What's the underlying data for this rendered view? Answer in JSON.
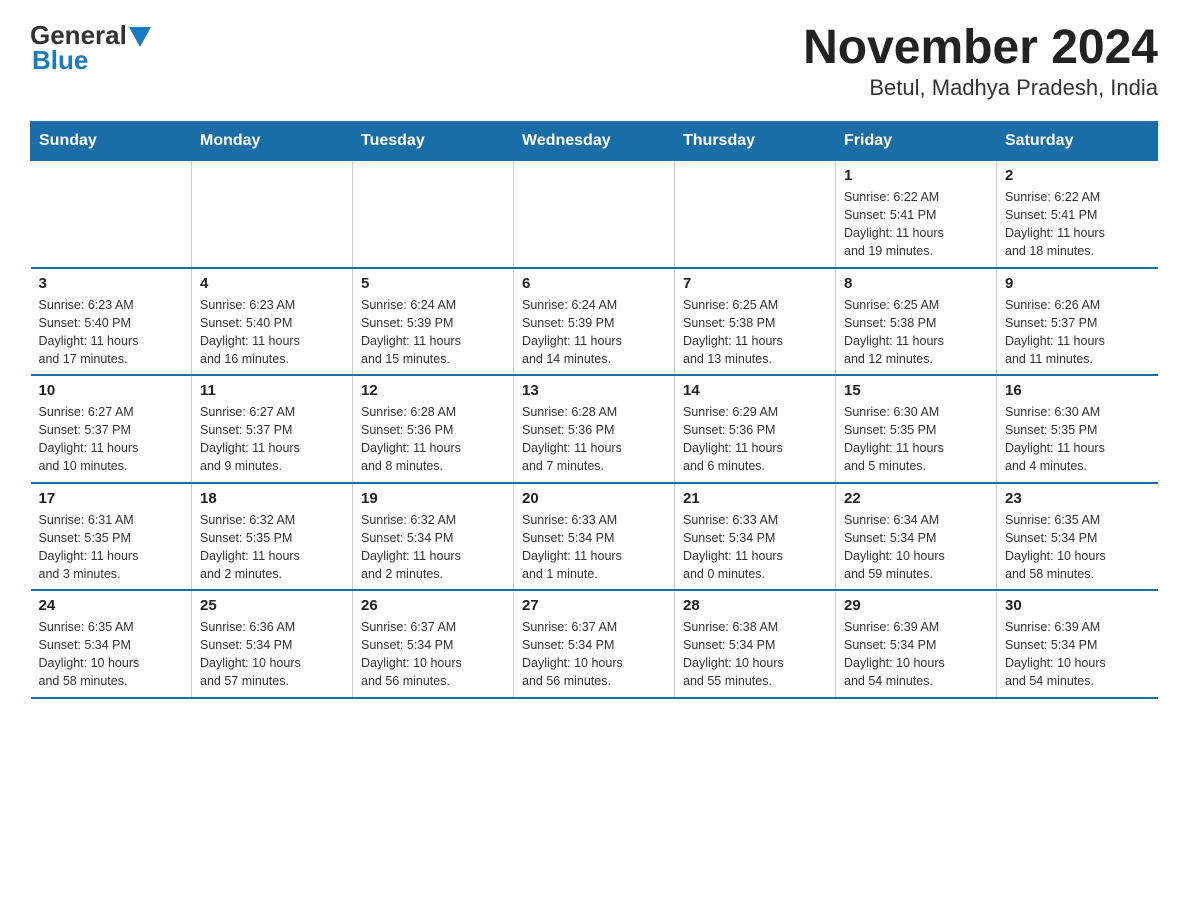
{
  "logo": {
    "general": "General",
    "blue": "Blue"
  },
  "title": "November 2024",
  "subtitle": "Betul, Madhya Pradesh, India",
  "days_header": [
    "Sunday",
    "Monday",
    "Tuesday",
    "Wednesday",
    "Thursday",
    "Friday",
    "Saturday"
  ],
  "weeks": [
    [
      {
        "day": "",
        "info": ""
      },
      {
        "day": "",
        "info": ""
      },
      {
        "day": "",
        "info": ""
      },
      {
        "day": "",
        "info": ""
      },
      {
        "day": "",
        "info": ""
      },
      {
        "day": "1",
        "info": "Sunrise: 6:22 AM\nSunset: 5:41 PM\nDaylight: 11 hours\nand 19 minutes."
      },
      {
        "day": "2",
        "info": "Sunrise: 6:22 AM\nSunset: 5:41 PM\nDaylight: 11 hours\nand 18 minutes."
      }
    ],
    [
      {
        "day": "3",
        "info": "Sunrise: 6:23 AM\nSunset: 5:40 PM\nDaylight: 11 hours\nand 17 minutes."
      },
      {
        "day": "4",
        "info": "Sunrise: 6:23 AM\nSunset: 5:40 PM\nDaylight: 11 hours\nand 16 minutes."
      },
      {
        "day": "5",
        "info": "Sunrise: 6:24 AM\nSunset: 5:39 PM\nDaylight: 11 hours\nand 15 minutes."
      },
      {
        "day": "6",
        "info": "Sunrise: 6:24 AM\nSunset: 5:39 PM\nDaylight: 11 hours\nand 14 minutes."
      },
      {
        "day": "7",
        "info": "Sunrise: 6:25 AM\nSunset: 5:38 PM\nDaylight: 11 hours\nand 13 minutes."
      },
      {
        "day": "8",
        "info": "Sunrise: 6:25 AM\nSunset: 5:38 PM\nDaylight: 11 hours\nand 12 minutes."
      },
      {
        "day": "9",
        "info": "Sunrise: 6:26 AM\nSunset: 5:37 PM\nDaylight: 11 hours\nand 11 minutes."
      }
    ],
    [
      {
        "day": "10",
        "info": "Sunrise: 6:27 AM\nSunset: 5:37 PM\nDaylight: 11 hours\nand 10 minutes."
      },
      {
        "day": "11",
        "info": "Sunrise: 6:27 AM\nSunset: 5:37 PM\nDaylight: 11 hours\nand 9 minutes."
      },
      {
        "day": "12",
        "info": "Sunrise: 6:28 AM\nSunset: 5:36 PM\nDaylight: 11 hours\nand 8 minutes."
      },
      {
        "day": "13",
        "info": "Sunrise: 6:28 AM\nSunset: 5:36 PM\nDaylight: 11 hours\nand 7 minutes."
      },
      {
        "day": "14",
        "info": "Sunrise: 6:29 AM\nSunset: 5:36 PM\nDaylight: 11 hours\nand 6 minutes."
      },
      {
        "day": "15",
        "info": "Sunrise: 6:30 AM\nSunset: 5:35 PM\nDaylight: 11 hours\nand 5 minutes."
      },
      {
        "day": "16",
        "info": "Sunrise: 6:30 AM\nSunset: 5:35 PM\nDaylight: 11 hours\nand 4 minutes."
      }
    ],
    [
      {
        "day": "17",
        "info": "Sunrise: 6:31 AM\nSunset: 5:35 PM\nDaylight: 11 hours\nand 3 minutes."
      },
      {
        "day": "18",
        "info": "Sunrise: 6:32 AM\nSunset: 5:35 PM\nDaylight: 11 hours\nand 2 minutes."
      },
      {
        "day": "19",
        "info": "Sunrise: 6:32 AM\nSunset: 5:34 PM\nDaylight: 11 hours\nand 2 minutes."
      },
      {
        "day": "20",
        "info": "Sunrise: 6:33 AM\nSunset: 5:34 PM\nDaylight: 11 hours\nand 1 minute."
      },
      {
        "day": "21",
        "info": "Sunrise: 6:33 AM\nSunset: 5:34 PM\nDaylight: 11 hours\nand 0 minutes."
      },
      {
        "day": "22",
        "info": "Sunrise: 6:34 AM\nSunset: 5:34 PM\nDaylight: 10 hours\nand 59 minutes."
      },
      {
        "day": "23",
        "info": "Sunrise: 6:35 AM\nSunset: 5:34 PM\nDaylight: 10 hours\nand 58 minutes."
      }
    ],
    [
      {
        "day": "24",
        "info": "Sunrise: 6:35 AM\nSunset: 5:34 PM\nDaylight: 10 hours\nand 58 minutes."
      },
      {
        "day": "25",
        "info": "Sunrise: 6:36 AM\nSunset: 5:34 PM\nDaylight: 10 hours\nand 57 minutes."
      },
      {
        "day": "26",
        "info": "Sunrise: 6:37 AM\nSunset: 5:34 PM\nDaylight: 10 hours\nand 56 minutes."
      },
      {
        "day": "27",
        "info": "Sunrise: 6:37 AM\nSunset: 5:34 PM\nDaylight: 10 hours\nand 56 minutes."
      },
      {
        "day": "28",
        "info": "Sunrise: 6:38 AM\nSunset: 5:34 PM\nDaylight: 10 hours\nand 55 minutes."
      },
      {
        "day": "29",
        "info": "Sunrise: 6:39 AM\nSunset: 5:34 PM\nDaylight: 10 hours\nand 54 minutes."
      },
      {
        "day": "30",
        "info": "Sunrise: 6:39 AM\nSunset: 5:34 PM\nDaylight: 10 hours\nand 54 minutes."
      }
    ]
  ]
}
